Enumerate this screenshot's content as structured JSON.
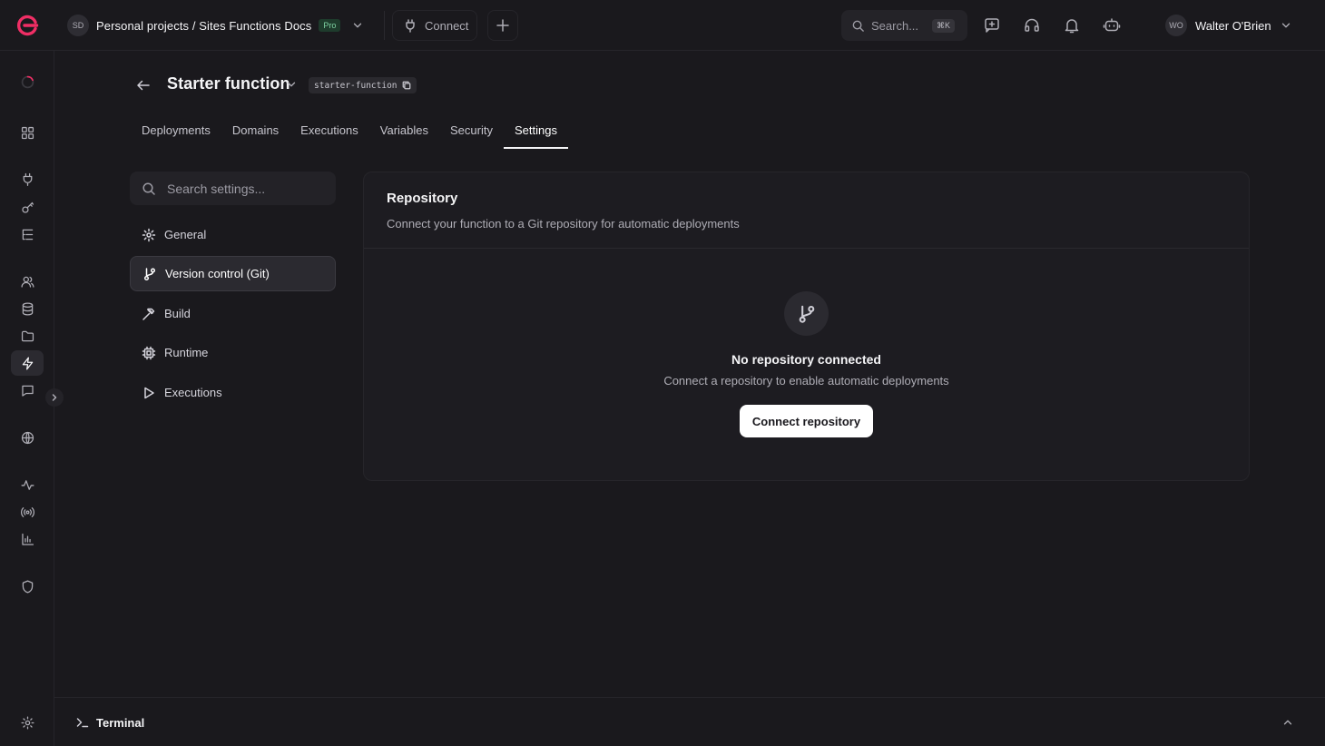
{
  "topbar": {
    "project_initials": "SD",
    "project_path": "Personal projects / Sites Functions Docs",
    "plan_badge": "Pro",
    "connect_label": "Connect",
    "search_placeholder": "Search...",
    "search_shortcut": "⌘K",
    "user_initials": "WO",
    "user_name": "Walter O'Brien"
  },
  "header": {
    "title": "Starter function",
    "slug": "starter-function"
  },
  "tabs": [
    {
      "label": "Deployments"
    },
    {
      "label": "Domains"
    },
    {
      "label": "Executions"
    },
    {
      "label": "Variables"
    },
    {
      "label": "Security"
    },
    {
      "label": "Settings",
      "active": true
    }
  ],
  "settings_nav": {
    "search_placeholder": "Search settings...",
    "items": [
      {
        "label": "General",
        "icon": "gear-icon"
      },
      {
        "label": "Version control (Git)",
        "icon": "git-branch-icon",
        "active": true
      },
      {
        "label": "Build",
        "icon": "hammer-icon"
      },
      {
        "label": "Runtime",
        "icon": "cpu-icon"
      },
      {
        "label": "Executions",
        "icon": "play-icon"
      }
    ]
  },
  "repository": {
    "title": "Repository",
    "description": "Connect your function to a Git repository for automatic deployments",
    "empty_title": "No repository connected",
    "empty_subtitle": "Connect a repository to enable automatic deployments",
    "cta_label": "Connect repository"
  },
  "terminal": {
    "label": "Terminal"
  },
  "colors": {
    "background": "#1a191d",
    "brand": "#f02e65",
    "card": "#1d1c21",
    "primary_button": "#ffffff"
  }
}
